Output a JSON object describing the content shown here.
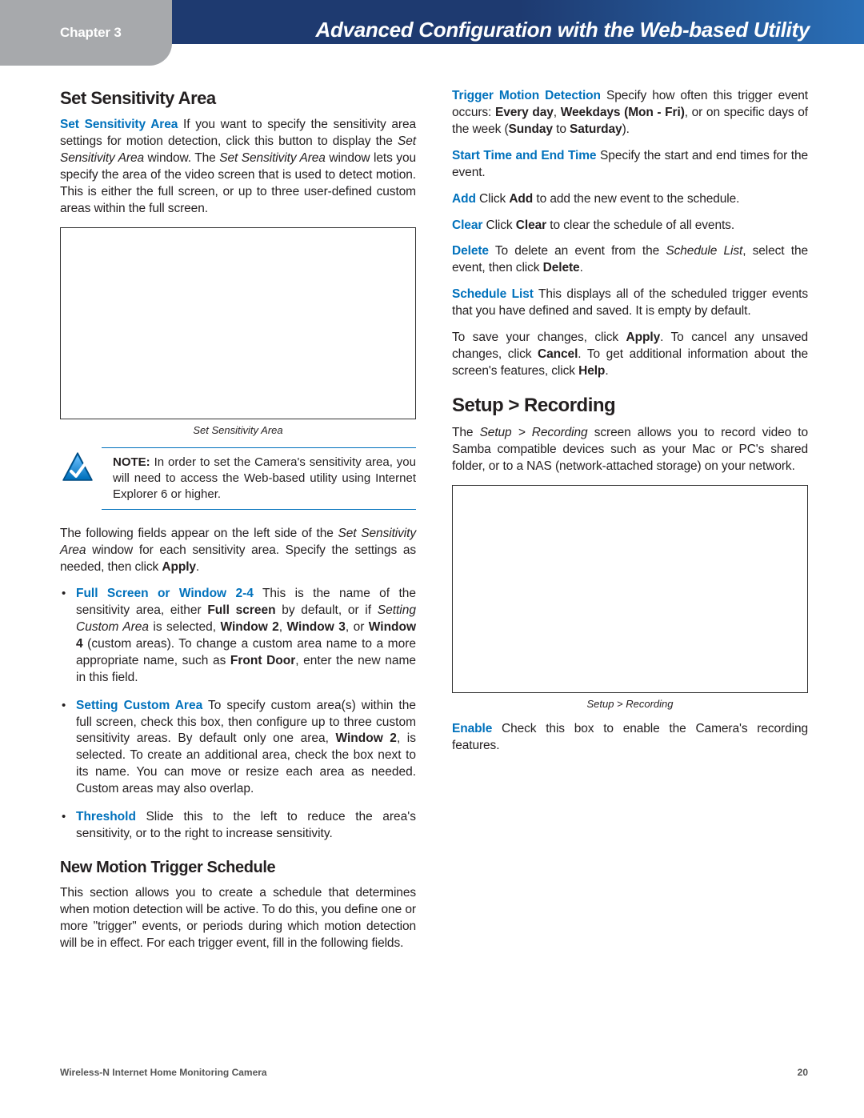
{
  "header": {
    "chapter": "Chapter 3",
    "title": "Advanced Configuration with the Web-based Utility"
  },
  "left": {
    "h_sensitivity": "Set Sensitivity Area",
    "p_sensitivity_term": "Set Sensitivity Area",
    "p_sensitivity_a": "  If you want to specify the sensitivity area settings for motion detection, click this button to display the ",
    "p_sensitivity_ital1": "Set Sensitivity Area",
    "p_sensitivity_b": " window. The ",
    "p_sensitivity_ital2": "Set Sensitivity Area",
    "p_sensitivity_c": " window lets you specify the area of the video screen that is used to detect motion. This is either the full screen, or up to three user-defined custom areas within the full screen.",
    "fig1_caption": "Set Sensitivity Area",
    "note_label": "NOTE:",
    "note_text": " In order to set the Camera's sensitivity area, you will need to access the Web-based utility using Internet Explorer 6 or higher.",
    "p_fields_a": "The following fields appear on the left side of the ",
    "p_fields_ital": "Set Sensitivity Area",
    "p_fields_b": " window for each sensitivity area. Specify the settings as needed, then click ",
    "p_fields_bold": "Apply",
    "p_fields_c": ".",
    "li1_term": "Full Screen or Window 2-4",
    "li1_a": "  This is the name of the sensitivity area, either ",
    "li1_b1": "Full screen",
    "li1_b": " by default, or if ",
    "li1_ital": "Setting Custom Area",
    "li1_c": " is selected, ",
    "li1_w2": "Window 2",
    "li1_d": ", ",
    "li1_w3": "Window 3",
    "li1_e": ", or ",
    "li1_w4": "Window 4",
    "li1_f": " (custom areas). To change a custom area name to a more appropriate name, such as ",
    "li1_fd": "Front Door",
    "li1_g": ", enter the new name in this field.",
    "li2_term": "Setting Custom Area",
    "li2_a": "  To specify custom area(s) within the full screen, check this box, then configure up to three custom sensitivity areas. By default only one area, ",
    "li2_w2": "Window 2",
    "li2_b": ", is selected. To create an additional area, check the box next to its name. You can move or resize each area as needed. Custom areas may also overlap.",
    "li3_term": "Threshold",
    "li3_text": "  Slide this to the left to reduce the area's sensitivity, or to the right to increase sensitivity.",
    "h_schedule": "New Motion Trigger Schedule",
    "p_schedule": "This section allows you to create a schedule that determines when motion detection will be active. To do this, you define one or more \"trigger\" events, or periods during which motion detection will be in effect. For each trigger event, fill in the following fields."
  },
  "right": {
    "p_trigger_term": "Trigger Motion Detection",
    "p_trigger_a": "  Specify how often this trigger event occurs: ",
    "p_trigger_b1": "Every day",
    "p_trigger_b": ", ",
    "p_trigger_b2": "Weekdays (Mon - Fri)",
    "p_trigger_c": ", or on specific days of the week (",
    "p_trigger_sun": "Sunday",
    "p_trigger_d": " to ",
    "p_trigger_sat": "Saturday",
    "p_trigger_e": ").",
    "p_time_term": "Start Time and End Time",
    "p_time_text": "  Specify the start and end times for the event.",
    "p_add_term": "Add",
    "p_add_a": "  Click ",
    "p_add_bold": "Add",
    "p_add_b": " to add the new event to the schedule.",
    "p_clear_term": "Clear",
    "p_clear_a": "  Click ",
    "p_clear_bold": "Clear",
    "p_clear_b": " to clear the schedule of all events.",
    "p_delete_term": "Delete",
    "p_delete_a": "  To delete an event from the ",
    "p_delete_ital": "Schedule List",
    "p_delete_b": ", select the event, then click ",
    "p_delete_bold": "Delete",
    "p_delete_c": ".",
    "p_list_term": "Schedule List",
    "p_list_text": "  This displays all of the scheduled trigger events that you have defined and saved. It is empty by default.",
    "p_save_a": "To save your changes, click ",
    "p_save_apply": "Apply",
    "p_save_b": ". To cancel any unsaved changes, click ",
    "p_save_cancel": "Cancel",
    "p_save_c": ". To get additional information about the screen's features, click ",
    "p_save_help": "Help",
    "p_save_d": ".",
    "h_recording": "Setup > Recording",
    "p_recording_a": "The ",
    "p_recording_ital": "Setup > Recording",
    "p_recording_b": " screen allows you to record video to Samba compatible devices such as your Mac or PC's shared folder, or to a NAS (network-attached storage) on your network.",
    "fig2_caption": "Setup > Recording",
    "p_enable_term": "Enable",
    "p_enable_text": "  Check this box to enable the Camera's recording features."
  },
  "footer": {
    "product": "Wireless-N Internet Home Monitoring Camera",
    "page": "20"
  }
}
